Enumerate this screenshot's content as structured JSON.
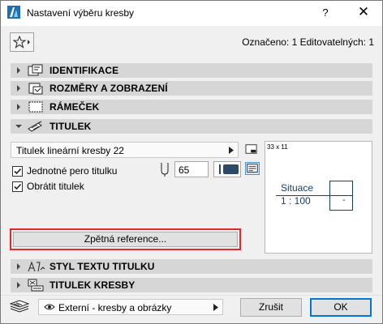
{
  "window": {
    "title": "Nastavení výběru kresby",
    "help_label": "?",
    "close_label": "✕"
  },
  "header": {
    "selected_info": "Označeno: 1 Editovatelných: 1"
  },
  "sections": [
    {
      "label": "IDENTIFIKACE",
      "icon": "identification-icon",
      "expanded": false
    },
    {
      "label": "ROZMĚRY A ZOBRAZENÍ",
      "icon": "dimensions-display-icon",
      "expanded": false
    },
    {
      "label": "RÁMEČEK",
      "icon": "frame-icon",
      "expanded": false
    },
    {
      "label": "TITULEK",
      "icon": "title-icon",
      "expanded": true
    },
    {
      "label": "STYL TEXTU TITULKU",
      "icon": "text-style-icon",
      "expanded": false
    },
    {
      "label": "TITULEK KRESBY",
      "icon": "drawing-title-icon",
      "expanded": false
    }
  ],
  "title_panel": {
    "title_type": "Titulek lineární kresby 22",
    "uniform_pen_label": "Jednotné pero titulku",
    "uniform_pen_checked": true,
    "flip_title_label": "Obrátit titulek",
    "flip_title_checked": true,
    "pen_value": "65",
    "pen_color": "#2c4a68",
    "cross_reference_label": "Zpětná reference..."
  },
  "preview": {
    "size": "33 x 11",
    "drawing_name": "Situace",
    "scale": "1 : 100",
    "number": "-"
  },
  "footer": {
    "layer_value": "Externí - kresby a obrázky",
    "cancel_label": "Zrušit",
    "ok_label": "OK"
  }
}
